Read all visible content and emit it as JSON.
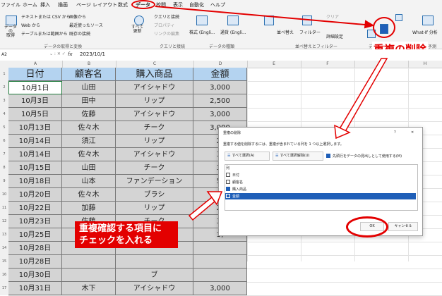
{
  "menubar": {
    "items": [
      "ファイル",
      "ホーム",
      "挿入",
      "描画",
      "ページ レイアウト",
      "数式",
      "データ",
      "校閲",
      "表示",
      "自動化",
      "ヘルプ"
    ]
  },
  "ribbon": {
    "get_data": "データの\n取得",
    "text_csv": "テキストまたは CSV から",
    "web": "Web から",
    "table_range": "テーブルまたは範囲から",
    "image_from": "画像から",
    "recent_sources": "最近使ったソース",
    "existing_conn": "既存の接続",
    "refresh_all": "すべて\n更新",
    "queries_conn": "クエリと接続",
    "properties": "プロパティ",
    "edit_links": "リンクの編集",
    "stocks": "株式 (Engli...",
    "currency": "通貨 (Engli...",
    "sort": "並べ替え",
    "filter": "フィルター",
    "clear": "クリア",
    "advanced": "詳細設定",
    "whatif": "What-If 分析",
    "group_get": "データの取得と変換",
    "group_query": "クエリと接続",
    "group_types": "データの種類",
    "group_sort": "並べ替えとフィルター",
    "group_tools": "デ",
    "group_forecast": "予測"
  },
  "formula_bar": {
    "cell_ref": "A2",
    "fx": "fx",
    "value": "2023/10/1"
  },
  "grid": {
    "columns": [
      "A",
      "B",
      "C",
      "D",
      "E",
      "F",
      "G",
      "H"
    ],
    "rows": [
      "1",
      "2",
      "3",
      "4",
      "5",
      "6",
      "7",
      "8",
      "9",
      "10",
      "11",
      "12",
      "13",
      "14",
      "15",
      "16",
      "17"
    ],
    "headers": [
      "日付",
      "顧客名",
      "購入商品",
      "金額"
    ],
    "data": [
      [
        "10月1日",
        "山田",
        "アイシャドウ",
        "3,000"
      ],
      [
        "10月3日",
        "田中",
        "リップ",
        "2,500"
      ],
      [
        "10月5日",
        "佐藤",
        "アイシャドウ",
        "3,000"
      ],
      [
        "10月13日",
        "佐々木",
        "チーク",
        "3,000"
      ],
      [
        "10月14日",
        "須江",
        "リップ",
        "2,"
      ],
      [
        "10月14日",
        "佐々木",
        "アイシャドウ",
        "3,"
      ],
      [
        "10月15日",
        "山田",
        "チーク",
        "3,"
      ],
      [
        "10月18日",
        "山本",
        "ファンデーション",
        "5,"
      ],
      [
        "10月20日",
        "佐々木",
        "ブラシ",
        "3,"
      ],
      [
        "10月22日",
        "加藤",
        "リップ",
        "2,"
      ],
      [
        "10月23日",
        "佐藤",
        "チーク",
        "3,"
      ],
      [
        "10月25日",
        "清水",
        "アイシャドウ",
        "3,"
      ],
      [
        "10月28日",
        "",
        "",
        " "
      ],
      [
        "10月28日",
        "",
        "",
        ""
      ],
      [
        "10月30日",
        "",
        "ブ",
        ""
      ],
      [
        "10月31日",
        "木下",
        "アイシャドウ",
        "3,000"
      ]
    ]
  },
  "dialog": {
    "title": "重複の削除",
    "question": "?",
    "close": "✕",
    "description": "重複する値を削除するには、重複が含まれている列を 1 つ以上選択します。",
    "select_all": "すべて選択(A)",
    "unselect_all": "すべて選択解除(U)",
    "header_option": "先頭行をデータの見出しとして使用する(M)",
    "column_label": "列",
    "options": [
      {
        "label": "日付",
        "checked": false
      },
      {
        "label": "顧客名",
        "checked": false
      },
      {
        "label": "購入商品",
        "checked": true
      },
      {
        "label": "金額",
        "checked": false
      }
    ],
    "ok": "OK",
    "cancel": "キャンセル"
  },
  "annotations": {
    "remove_dup": "重複の削除",
    "check_text_line1": "重複確認する項目に",
    "check_text_line2": "チェックを入れる"
  },
  "colors": {
    "accent_red": "#e30000",
    "header_blue": "#b4d3f0",
    "selection_gray": "#d4d4d4",
    "excel_blue": "#1f5fb8"
  }
}
